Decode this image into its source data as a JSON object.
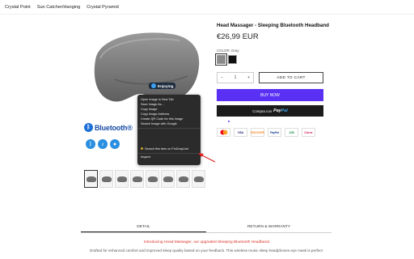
{
  "nav": {
    "items": [
      {
        "label": "Crystal Point"
      },
      {
        "label": "Sun Catcher/Hanging"
      },
      {
        "label": "Crystal Pyramid"
      }
    ]
  },
  "image": {
    "brand_text": "Bluetooth®",
    "badge_text": "Enjoying",
    "feature_icons": [
      "bluetooth-icon",
      "music-note-icon",
      "microphone-icon"
    ]
  },
  "context_menu": {
    "items": [
      {
        "label": "Open Image in New Tab"
      },
      {
        "label": "Save Image As..."
      },
      {
        "label": "Copy Image"
      },
      {
        "label": "Copy Image Address"
      },
      {
        "label": "Create QR Code for this Image"
      },
      {
        "label": "Search Image with Google"
      }
    ],
    "extension_item": "Search this item on FinDropLink",
    "inspect": "Inspect"
  },
  "thumbnails": {
    "count": 8,
    "active_index": 0
  },
  "product": {
    "title": "Head Massager - Sleeping Bluetooth Headband",
    "price": "€26,99 EUR",
    "color_label": "COLOR: Gray",
    "swatches": [
      {
        "name": "Gray",
        "color": "#8a8a8a",
        "selected": true
      },
      {
        "name": "Black",
        "color": "#111111",
        "selected": false
      }
    ],
    "quantity": "1",
    "qty_minus": "−",
    "qty_plus": "+",
    "add_to_cart": "ADD TO CART",
    "buy_now": "BUY NOW",
    "paypal_prefix": "Compra con",
    "paypal_brand_1": "Pay",
    "paypal_brand_2": "Pal",
    "accent_color": "#5a31f4"
  },
  "payments": [
    {
      "name": "mastercard",
      "label": "MC"
    },
    {
      "name": "visa",
      "label": "VISA"
    },
    {
      "name": "discover",
      "label": "DISCOVER"
    },
    {
      "name": "paypal",
      "label": "PayPal"
    },
    {
      "name": "jcb",
      "label": "JCB"
    },
    {
      "name": "klarna",
      "label": "Klarna"
    }
  ],
  "tabs": [
    {
      "label": "DETAIL",
      "active": true
    },
    {
      "label": "RETURN & WARRANTY",
      "active": false
    }
  ],
  "description": {
    "intro": "Introducing Head Massager, our upgraded Sleeping Bluetooth Headband.",
    "body": "Drafted for enhanced comfort and improved sleep quality based on your feedback. This wireless music sleep headphones eye mask is perfect"
  }
}
